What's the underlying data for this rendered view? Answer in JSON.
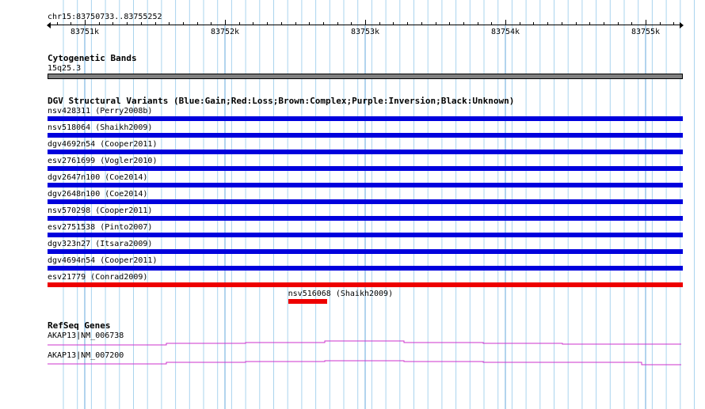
{
  "ruler": {
    "location": "chr15:83750733..83755252",
    "ticks": [
      {
        "pos": 83751000,
        "label": "83751k"
      },
      {
        "pos": 83752000,
        "label": "83752k"
      },
      {
        "pos": 83753000,
        "label": "83753k"
      },
      {
        "pos": 83754000,
        "label": "83754k"
      },
      {
        "pos": 83755000,
        "label": "83755k"
      }
    ]
  },
  "cytoband": {
    "title": "Cytogenetic Bands",
    "band_label": "15q25.3",
    "color": "#808080"
  },
  "dgv": {
    "title": "DGV Structural Variants (Blue:Gain;Red:Loss;Brown:Complex;Purple:Inversion;Black:Unknown)",
    "colors": {
      "gain": "#0000dd",
      "loss": "#ee0000"
    },
    "variants": [
      {
        "id": "nsv428311",
        "label": "nsv428311 (Perry2008b)",
        "type": "gain"
      },
      {
        "id": "nsv518064",
        "label": "nsv518064 (Shaikh2009)",
        "type": "gain"
      },
      {
        "id": "dgv4692n54",
        "label": "dgv4692n54 (Cooper2011)",
        "type": "gain"
      },
      {
        "id": "esv2761699",
        "label": "esv2761699 (Vogler2010)",
        "type": "gain"
      },
      {
        "id": "dgv2647n100",
        "label": "dgv2647n100 (Coe2014)",
        "type": "gain"
      },
      {
        "id": "dgv2648n100",
        "label": "dgv2648n100 (Coe2014)",
        "type": "gain"
      },
      {
        "id": "nsv570298",
        "label": "nsv570298 (Cooper2011)",
        "type": "gain"
      },
      {
        "id": "esv2751538",
        "label": "esv2751538 (Pinto2007)",
        "type": "gain"
      },
      {
        "id": "dgv323n27",
        "label": "dgv323n27 (Itsara2009)",
        "type": "gain"
      },
      {
        "id": "dgv4694n54",
        "label": "dgv4694n54 (Cooper2011)",
        "type": "gain"
      },
      {
        "id": "esv21779",
        "label": "esv21779 (Conrad2009)",
        "type": "loss"
      },
      {
        "id": "nsv516068",
        "label": "nsv516068 (Shaikh2009)",
        "type": "loss",
        "start": 83752450,
        "end": 83752730
      }
    ]
  },
  "refseq": {
    "title": "RefSeq Genes",
    "color": "#cc33cc",
    "genes": [
      {
        "label": "AKAP13|NM_006738"
      },
      {
        "label": "AKAP13|NM_007200"
      }
    ]
  }
}
